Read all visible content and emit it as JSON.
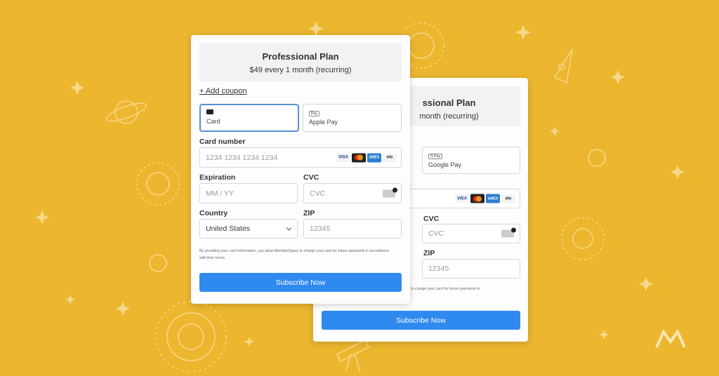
{
  "colors": {
    "background": "#ecb72f",
    "accent": "#2f8af0",
    "active_border": "#5a8fd8"
  },
  "front": {
    "plan_title": "Professional Plan",
    "plan_price": "$49 every 1 month (recurring)",
    "coupon": "+ Add coupon",
    "tabs": [
      {
        "label": "Card",
        "icon": "credit-card-icon"
      },
      {
        "label": "Apple Pay",
        "icon": "apple-pay-icon",
        "badge": "Pay"
      }
    ],
    "card_number_label": "Card number",
    "card_number_placeholder": "1234 1234 1234 1234",
    "brands": [
      "VISA",
      "",
      "AMEX",
      "elo"
    ],
    "expiration_label": "Expiration",
    "expiration_placeholder": "MM / YY",
    "cvc_label": "CVC",
    "cvc_placeholder": "CVC",
    "country_label": "Country",
    "country_value": "United States",
    "zip_label": "ZIP",
    "zip_placeholder": "12345",
    "terms": "By providing your card information, you allow MemberSpace to charge your card for future payments in accordance with their terms.",
    "subscribe": "Subscribe Now"
  },
  "back": {
    "plan_title": "ssional Plan",
    "plan_price": "month (recurring)",
    "tab_label": "Google Pay",
    "tab_badge": "G Pay",
    "cvc_label": "CVC",
    "cvc_placeholder": "CVC",
    "zip_label": "ZIP",
    "zip_placeholder": "12345",
    "terms": "berSpace to charge your card for future payments in",
    "subscribe": "Subscribe Now"
  }
}
